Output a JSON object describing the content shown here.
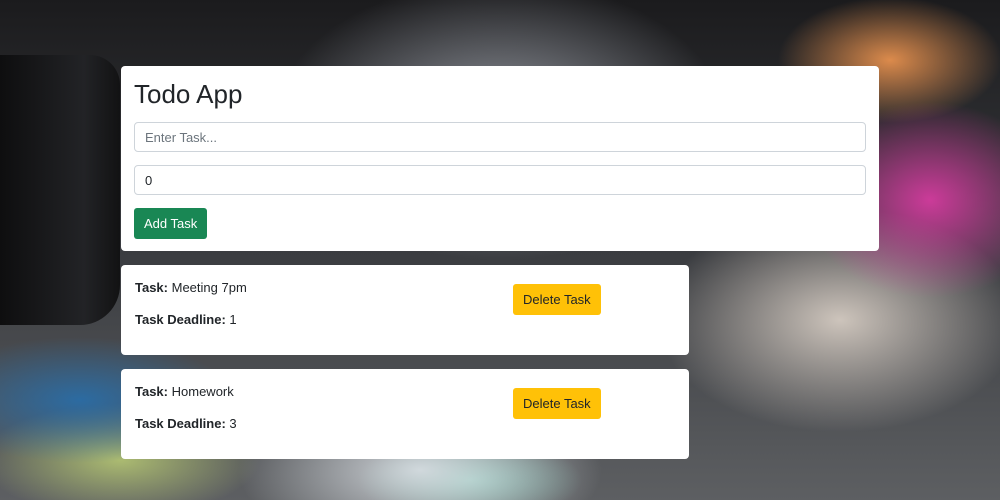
{
  "app": {
    "title": "Todo App"
  },
  "form": {
    "task_placeholder": "Enter Task...",
    "task_value": "",
    "deadline_value": "0",
    "add_label": "Add Task"
  },
  "labels": {
    "task": "Task:",
    "deadline": "Task Deadline:",
    "delete": "Delete Task"
  },
  "tasks": [
    {
      "name": "Meeting 7pm",
      "deadline": "1"
    },
    {
      "name": "Homework",
      "deadline": "3"
    }
  ],
  "colors": {
    "add_button": "#198754",
    "delete_button": "#ffc107"
  }
}
